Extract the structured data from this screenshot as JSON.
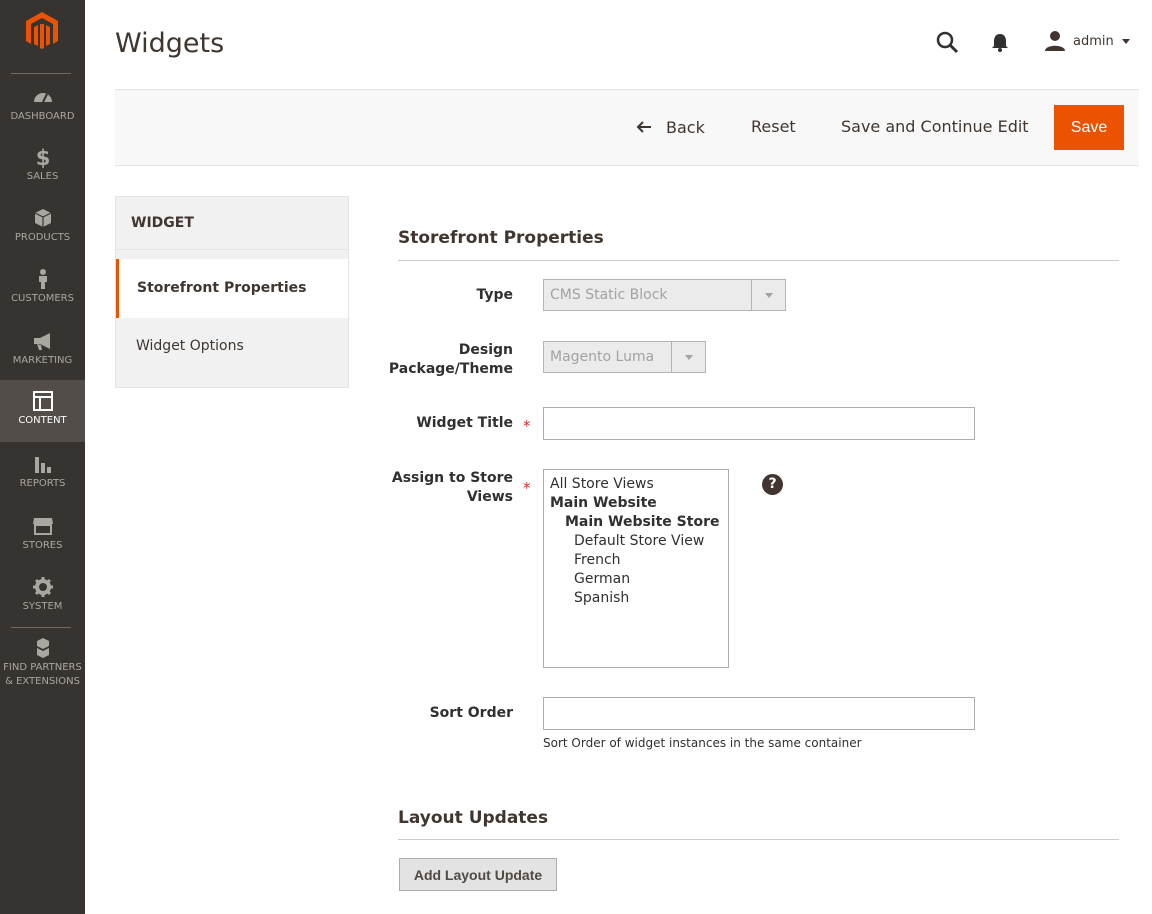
{
  "sidebar": {
    "logo": "magento-logo-icon",
    "items": [
      {
        "label": "DASHBOARD",
        "icon": "dashboard-icon"
      },
      {
        "label": "SALES",
        "icon": "dollar-icon"
      },
      {
        "label": "PRODUCTS",
        "icon": "cube-icon"
      },
      {
        "label": "CUSTOMERS",
        "icon": "person-icon"
      },
      {
        "label": "MARKETING",
        "icon": "megaphone-icon"
      },
      {
        "label": "CONTENT",
        "icon": "layout-icon",
        "active": true
      },
      {
        "label": "REPORTS",
        "icon": "bar-chart-icon"
      },
      {
        "label": "STORES",
        "icon": "storefront-icon"
      },
      {
        "label": "SYSTEM",
        "icon": "gear-icon"
      },
      {
        "label": "FIND PARTNERS & EXTENSIONS",
        "icon": "boxes-icon"
      }
    ]
  },
  "header": {
    "title": "Widgets",
    "user": "admin"
  },
  "actions": {
    "back": "Back",
    "reset": "Reset",
    "save_continue": "Save and Continue Edit",
    "save": "Save"
  },
  "tabs": {
    "title": "WIDGET",
    "items": [
      "Storefront Properties",
      "Widget Options"
    ]
  },
  "form": {
    "section_title": "Storefront Properties",
    "type_label": "Type",
    "type_value": "CMS Static Block",
    "theme_label_1": "Design",
    "theme_label_2": "Package/Theme",
    "theme_value": "Magento Luma",
    "widget_title_label": "Widget Title",
    "widget_title_value": "",
    "store_views_label_1": "Assign to Store",
    "store_views_label_2": "Views",
    "store_views": [
      "All Store Views",
      "Main Website",
      "Main Website Store",
      "Default Store View",
      "French",
      "German",
      "Spanish"
    ],
    "help_symbol": "?",
    "sort_order_label": "Sort Order",
    "sort_order_value": "",
    "sort_order_note": "Sort Order of widget instances in the same container",
    "required_mark": "*"
  },
  "layout_updates": {
    "title": "Layout Updates",
    "add_button": "Add Layout Update"
  },
  "colors": {
    "sidebar_bg": "#373330",
    "accent": "#eb5202",
    "active_nav_bg": "#524d49"
  }
}
